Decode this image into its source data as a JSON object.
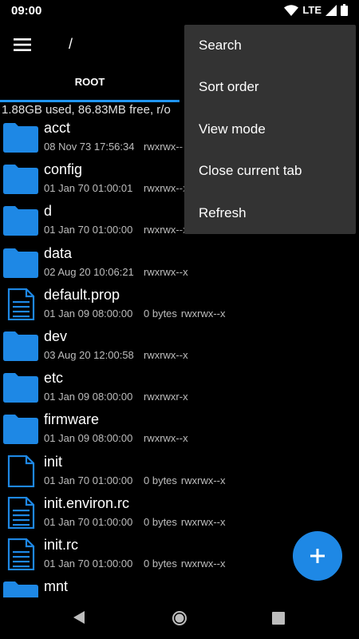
{
  "status_bar": {
    "time": "09:00",
    "network": "LTE"
  },
  "app_bar": {
    "path": "/"
  },
  "tabs": [
    {
      "label": "ROOT"
    }
  ],
  "storage": {
    "info": "1.88GB used, 86.83MB free, r/o"
  },
  "files": [
    {
      "name": "acct",
      "type": "folder",
      "date": "08 Nov 73 17:56:34",
      "size": "",
      "perms": "rwxrwx--"
    },
    {
      "name": "config",
      "type": "folder",
      "date": "01 Jan 70 01:00:01",
      "size": "",
      "perms": "rwxrwx--x"
    },
    {
      "name": "d",
      "type": "folder",
      "date": "01 Jan 70 01:00:00",
      "size": "",
      "perms": "rwxrwx--x"
    },
    {
      "name": "data",
      "type": "folder",
      "date": "02 Aug 20 10:06:21",
      "size": "",
      "perms": "rwxrwx--x"
    },
    {
      "name": "default.prop",
      "type": "text-file",
      "date": "01 Jan 09 08:00:00",
      "size": "0 bytes",
      "perms": "rwxrwx--x"
    },
    {
      "name": "dev",
      "type": "folder",
      "date": "03 Aug 20 12:00:58",
      "size": "",
      "perms": "rwxrwx--x"
    },
    {
      "name": "etc",
      "type": "folder",
      "date": "01 Jan 09 08:00:00",
      "size": "",
      "perms": "rwxrwxr-x"
    },
    {
      "name": "firmware",
      "type": "folder",
      "date": "01 Jan 09 08:00:00",
      "size": "",
      "perms": "rwxrwx--x"
    },
    {
      "name": "init",
      "type": "file",
      "date": "01 Jan 70 01:00:00",
      "size": "0 bytes",
      "perms": "rwxrwx--x"
    },
    {
      "name": "init.environ.rc",
      "type": "text-file",
      "date": "01 Jan 70 01:00:00",
      "size": "0 bytes",
      "perms": "rwxrwx--x"
    },
    {
      "name": "init.rc",
      "type": "text-file",
      "date": "01 Jan 70 01:00:00",
      "size": "0 bytes",
      "perms": "rwxrwx--x"
    },
    {
      "name": "mnt",
      "type": "folder",
      "date": "",
      "size": "",
      "perms": ""
    }
  ],
  "overflow_menu": {
    "items": [
      {
        "label": "Search"
      },
      {
        "label": "Sort order"
      },
      {
        "label": "View mode"
      },
      {
        "label": "Close current tab"
      },
      {
        "label": "Refresh"
      }
    ]
  },
  "fab": {
    "icon": "plus-icon"
  },
  "colors": {
    "accent": "#2196f3",
    "folder": "#1e88e5",
    "menu_bg": "#333333"
  }
}
